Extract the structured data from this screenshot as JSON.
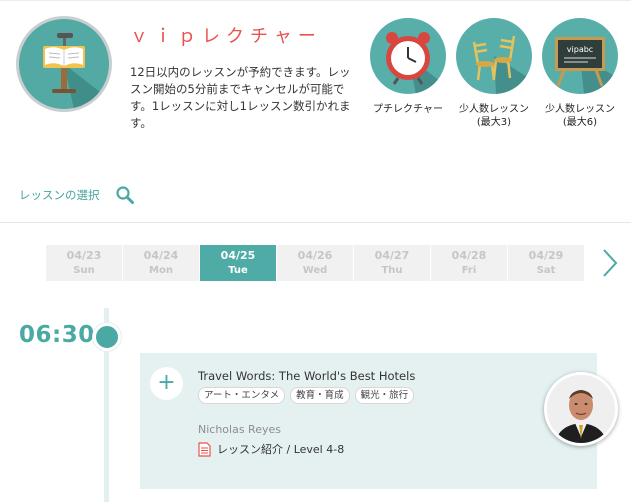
{
  "header": {
    "course_title": "ｖｉｐレクチャー",
    "description": "12日以内のレッスンが予約できます。レッスン開始の5分前までキャンセルが可能です。1レッスンに対し1レッスン数引かれます。"
  },
  "features": [
    {
      "label": "プチレクチャー",
      "icon": "alarm-clock-icon"
    },
    {
      "label": "少人数レッスン\n(最大3)",
      "icon": "two-chairs-icon"
    },
    {
      "label": "少人数レッスン\n(最大6)",
      "icon": "chalkboard-icon",
      "board_text": "vipabc"
    }
  ],
  "lesson_select": {
    "label": "レッスンの選択",
    "icon": "search-icon"
  },
  "dates": [
    {
      "date": "04/23",
      "weekday": "Sun",
      "active": false
    },
    {
      "date": "04/24",
      "weekday": "Mon",
      "active": false
    },
    {
      "date": "04/25",
      "weekday": "Tue",
      "active": true
    },
    {
      "date": "04/26",
      "weekday": "Wed",
      "active": false
    },
    {
      "date": "04/27",
      "weekday": "Thu",
      "active": false
    },
    {
      "date": "04/28",
      "weekday": "Fri",
      "active": false
    },
    {
      "date": "04/29",
      "weekday": "Sat",
      "active": false
    }
  ],
  "timeline": {
    "time": "06:30"
  },
  "lesson": {
    "add_symbol": "+",
    "title": "Travel Words: The World's Best Hotels",
    "tags": [
      "アート・エンタメ",
      "教育・育成",
      "観光・旅行"
    ],
    "teacher": "Nicholas Reyes",
    "intro": "レッスン紹介 / Level 4-8"
  },
  "colors": {
    "accent": "#4ba9a4",
    "title_red": "#e8534f",
    "card_bg": "#e5f1f1"
  }
}
